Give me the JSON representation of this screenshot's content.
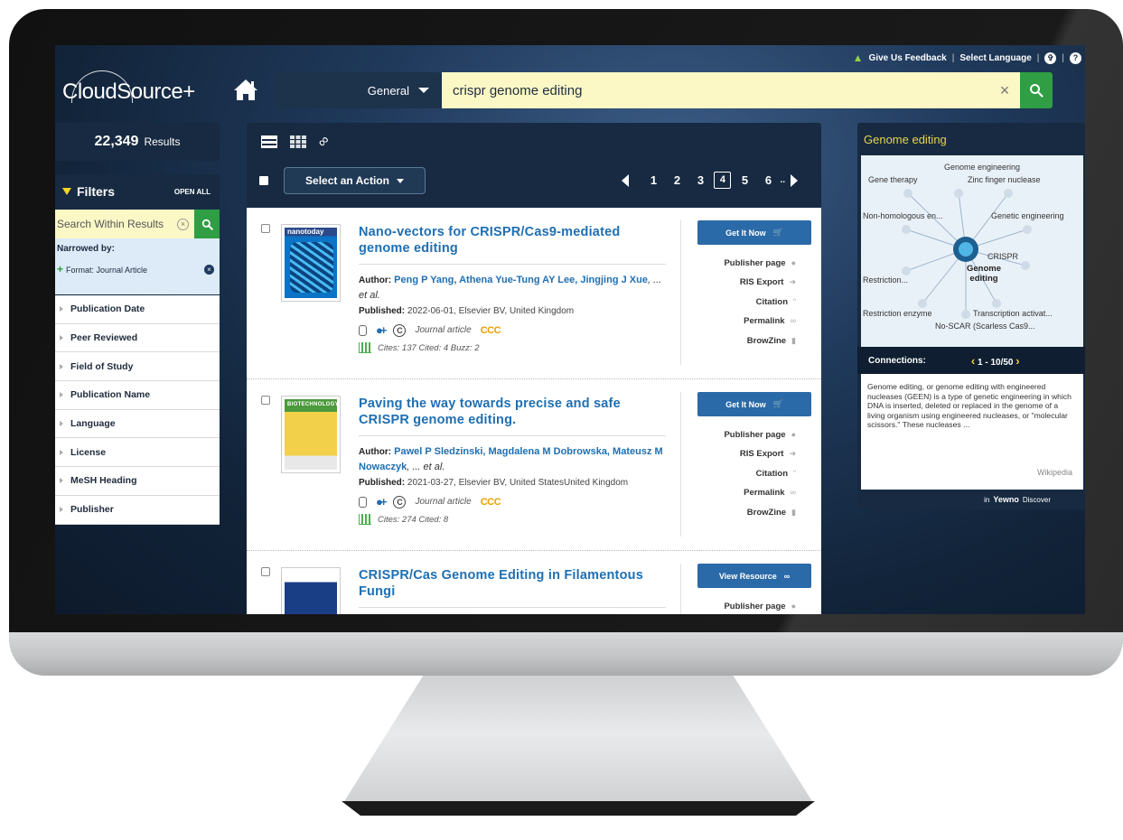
{
  "topbar": {
    "feedback": "Give Us Feedback",
    "language": "Select Language",
    "accessibility_glyph": "✞",
    "help_glyph": "?"
  },
  "logo": {
    "text": "CloudSource+"
  },
  "search": {
    "scope": "General",
    "query": "crispr genome editing",
    "clear_glyph": "×"
  },
  "sidebar": {
    "results_count": "22,349",
    "results_label": "Results",
    "filters_title": "Filters",
    "open_all": "OPEN ALL",
    "within_placeholder": "Search Within Results",
    "narrowed_label": "Narrowed by:",
    "narrowed_item": "Format: Journal Article",
    "facets": [
      "Publication Date",
      "Peer Reviewed",
      "Field of Study",
      "Publication Name",
      "Language",
      "License",
      "MeSH Heading",
      "Publisher"
    ]
  },
  "toolbar": {
    "action_label": "Select an Action",
    "pages": [
      "1",
      "2",
      "3",
      "4",
      "5",
      "6"
    ],
    "current_page": "4",
    "ellipsis": ".."
  },
  "records": [
    {
      "cover_text": "nanotoday",
      "title": "Nano-vectors for CRISPR/Cas9-mediated genome editing",
      "author_label": "Author:",
      "authors": "Peng P Yang, Athena Yue-Tung AY Lee, Jingjing J Xue",
      "et_al": ", ... et al.",
      "published_label": "Published:",
      "published": "2022-06-01, Elsevier BV, United Kingdom",
      "type": "Journal article",
      "ccc": "CCC",
      "cites": "Cites: 137  Cited: 4  Buzz: 2",
      "button": "Get It Now",
      "links": [
        "Publisher page",
        "RIS Export",
        "Citation",
        "Permalink",
        "BrowZine"
      ]
    },
    {
      "cover_text": "BIOTECHNOLOGY",
      "title": "Paving the way towards precise and safe CRISPR genome editing.",
      "author_label": "Author:",
      "authors": "Pawel P Sledzinski, Magdalena M Dobrowska, Mateusz M Nowaczyk",
      "et_al": ", ... et al.",
      "published_label": "Published:",
      "published": "2021-03-27, Elsevier BV, United StatesUnited Kingdom",
      "type": "Journal article",
      "ccc": "CCC",
      "cites": "Cites: 274  Cited: 8",
      "button": "Get It Now",
      "links": [
        "Publisher page",
        "RIS Export",
        "Citation",
        "Permalink",
        "BrowZine"
      ]
    },
    {
      "title": "CRISPR/Cas Genome Editing in Filamentous Fungi",
      "button": "View Resource",
      "links": [
        "Publisher page"
      ]
    }
  ],
  "topic": {
    "title": "Genome editing",
    "center": "Genome editing",
    "nodes": [
      "Genome engineering",
      "Gene therapy",
      "Zinc finger nuclease",
      "Non-homologous en...",
      "Genetic engineering",
      "CRISPR",
      "Restriction...",
      "Restriction enzyme",
      "Transcription activat...",
      "No-SCAR (Scarless Cas9..."
    ],
    "connections_label": "Connections:",
    "connections_range": "1 - 10/50",
    "description": "Genome editing, or genome editing with engineered nucleases (GEEN) is a type of genetic engineering in which DNA is inserted, deleted or replaced in the genome of a living organism using engineered nucleases, or \"molecular scissors.\" These nucleases ...",
    "source": "Wikipedia",
    "footer_in": "in",
    "footer_brand": "Yewno",
    "footer_discover": "Discover"
  },
  "colors": {
    "accent_green": "#2f9e44",
    "link_blue": "#1f6fb2",
    "navy": "#172a41",
    "search_bg": "#fcf8c6",
    "topic_yellow": "#e6d54a"
  }
}
